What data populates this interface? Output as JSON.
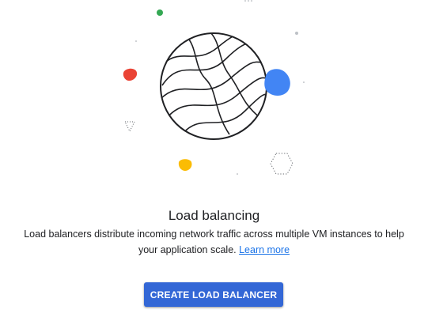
{
  "empty_state": {
    "title": "Load balancing",
    "description": "Load balancers distribute incoming network traffic across multiple VM instances to help your application scale.",
    "learn_more_label": "Learn more",
    "create_button_label": "CREATE LOAD BALANCER"
  },
  "colors": {
    "accent_blue": "#4285f4",
    "button_blue": "#3367d6",
    "link_blue": "#1a73e8",
    "red": "#ea4335",
    "yellow": "#fbbc04",
    "green": "#34a853"
  },
  "illustration": {
    "icons": [
      "globe-icon",
      "red-blob-icon",
      "blue-blob-icon",
      "yellow-blob-icon",
      "green-dot-icon",
      "dotted-hexagon-icon",
      "dotted-triangle-icon"
    ]
  }
}
